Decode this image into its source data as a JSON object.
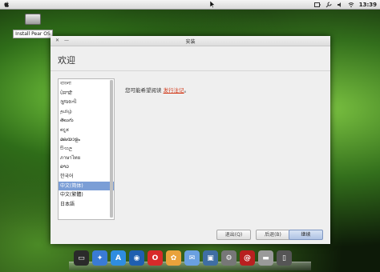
{
  "top_panel": {
    "clock": "13:39"
  },
  "desktop": {
    "install_icon_label": "Install Pear OS"
  },
  "window": {
    "title": "安装",
    "heading": "欢迎",
    "prompt_text": "您可能希望阅读",
    "release_notes_link": "发行注记",
    "prompt_suffix": "。",
    "languages": [
      "বাংলা",
      "ਪੰਜਾਬੀ",
      "ગુજરાતી",
      "தமிழ்",
      "తెలుగు",
      "ಕನ್ನಡ",
      "മലയാളം",
      "සිංහල",
      "ภาษาไทย",
      "ລາວ",
      "한국어",
      "中文(简体)",
      "中文(繁體)",
      "日本語"
    ],
    "selected_language_index": 11,
    "buttons": {
      "quit": "退出(Q)",
      "back": "后退(B)",
      "continue": "继续"
    }
  },
  "dock": {
    "apps": [
      {
        "icon": "monitor-icon",
        "color": "#2a2a2a"
      },
      {
        "icon": "compass-icon",
        "color": "#3a7bd5"
      },
      {
        "icon": "app-store-icon",
        "color": "#2f8de0"
      },
      {
        "icon": "browser-icon",
        "color": "#1f5fb0"
      },
      {
        "icon": "opera-icon",
        "color": "#d82a2a"
      },
      {
        "icon": "photo-icon",
        "color": "#e9a23b"
      },
      {
        "icon": "mail-icon",
        "color": "#6aa0e0"
      },
      {
        "icon": "preview-icon",
        "color": "#3f6ea3"
      },
      {
        "icon": "utility-icon",
        "color": "#777777"
      },
      {
        "icon": "email-icon",
        "color": "#b82020"
      },
      {
        "icon": "drive-icon",
        "color": "#9a9a9a"
      },
      {
        "icon": "trash-icon",
        "color": "#555555"
      }
    ]
  }
}
